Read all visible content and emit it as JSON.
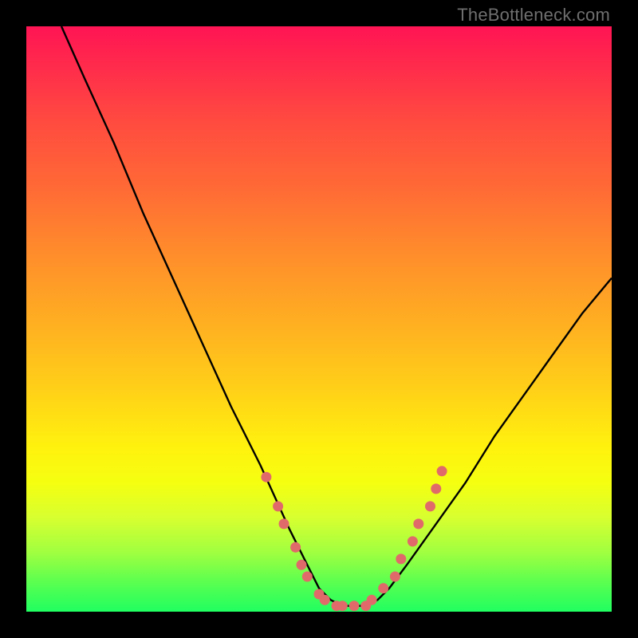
{
  "watermark": "TheBottleneck.com",
  "chart_data": {
    "type": "line",
    "title": "",
    "xlabel": "",
    "ylabel": "",
    "xlim": [
      0,
      100
    ],
    "ylim": [
      0,
      100
    ],
    "series": [
      {
        "name": "bottleneck-curve",
        "x": [
          6,
          10,
          15,
          20,
          25,
          30,
          35,
          40,
          45,
          48,
          50,
          52,
          54,
          56,
          58,
          60,
          62,
          65,
          70,
          75,
          80,
          85,
          90,
          95,
          100
        ],
        "y": [
          100,
          91,
          80,
          68,
          57,
          46,
          35,
          25,
          14,
          8,
          4,
          2,
          1,
          1,
          1,
          2,
          4,
          8,
          15,
          22,
          30,
          37,
          44,
          51,
          57
        ]
      }
    ],
    "markers": {
      "name": "highlight-dots",
      "color": "#e06a6a",
      "points": [
        {
          "x": 41,
          "y": 23
        },
        {
          "x": 43,
          "y": 18
        },
        {
          "x": 44,
          "y": 15
        },
        {
          "x": 46,
          "y": 11
        },
        {
          "x": 47,
          "y": 8
        },
        {
          "x": 48,
          "y": 6
        },
        {
          "x": 50,
          "y": 3
        },
        {
          "x": 51,
          "y": 2
        },
        {
          "x": 53,
          "y": 1
        },
        {
          "x": 54,
          "y": 1
        },
        {
          "x": 56,
          "y": 1
        },
        {
          "x": 58,
          "y": 1
        },
        {
          "x": 59,
          "y": 2
        },
        {
          "x": 61,
          "y": 4
        },
        {
          "x": 63,
          "y": 6
        },
        {
          "x": 64,
          "y": 9
        },
        {
          "x": 66,
          "y": 12
        },
        {
          "x": 67,
          "y": 15
        },
        {
          "x": 69,
          "y": 18
        },
        {
          "x": 70,
          "y": 21
        },
        {
          "x": 71,
          "y": 24
        }
      ]
    },
    "gradient_stops": [
      {
        "pos": 0,
        "color": "#ff1454"
      },
      {
        "pos": 50,
        "color": "#ffad22"
      },
      {
        "pos": 78,
        "color": "#f5ff10"
      },
      {
        "pos": 100,
        "color": "#20ff60"
      }
    ]
  }
}
